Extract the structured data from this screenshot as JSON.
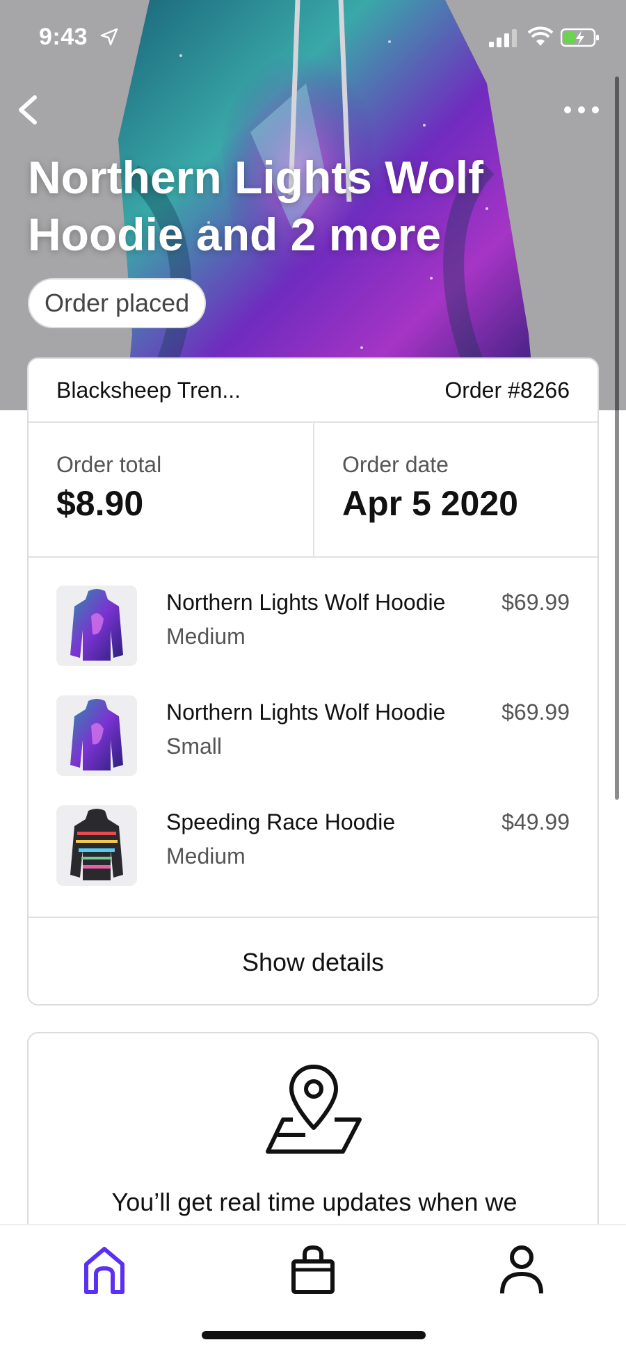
{
  "status_bar": {
    "time": "9:43"
  },
  "header": {
    "title": "Northern Lights Wolf Hoodie and 2 more",
    "status_pill": "Order placed"
  },
  "order": {
    "store": "Blacksheep Tren...",
    "number": "Order #8266",
    "total_label": "Order total",
    "total_value": "$8.90",
    "date_label": "Order date",
    "date_value": "Apr 5 2020",
    "items": [
      {
        "name": "Northern Lights Wolf Hoodie",
        "size": "Medium",
        "price": "$69.99",
        "thumb_icon": "aurora-hoodie-image"
      },
      {
        "name": "Northern Lights Wolf Hoodie",
        "size": "Small",
        "price": "$69.99",
        "thumb_icon": "aurora-hoodie-image"
      },
      {
        "name": "Speeding Race Hoodie",
        "size": "Medium",
        "price": "$49.99",
        "thumb_icon": "race-hoodie-image"
      }
    ],
    "show_details_label": "Show details"
  },
  "tracking": {
    "icon": "map-pin-icon",
    "text": "You’ll get real time updates when we"
  },
  "tab_bar": {
    "items": [
      {
        "name": "home",
        "icon": "home-icon",
        "active": true
      },
      {
        "name": "orders",
        "icon": "shopping-bag-icon",
        "active": false
      },
      {
        "name": "profile",
        "icon": "person-icon",
        "active": false
      }
    ],
    "active_color": "#5a31f4",
    "inactive_color": "#111111"
  }
}
